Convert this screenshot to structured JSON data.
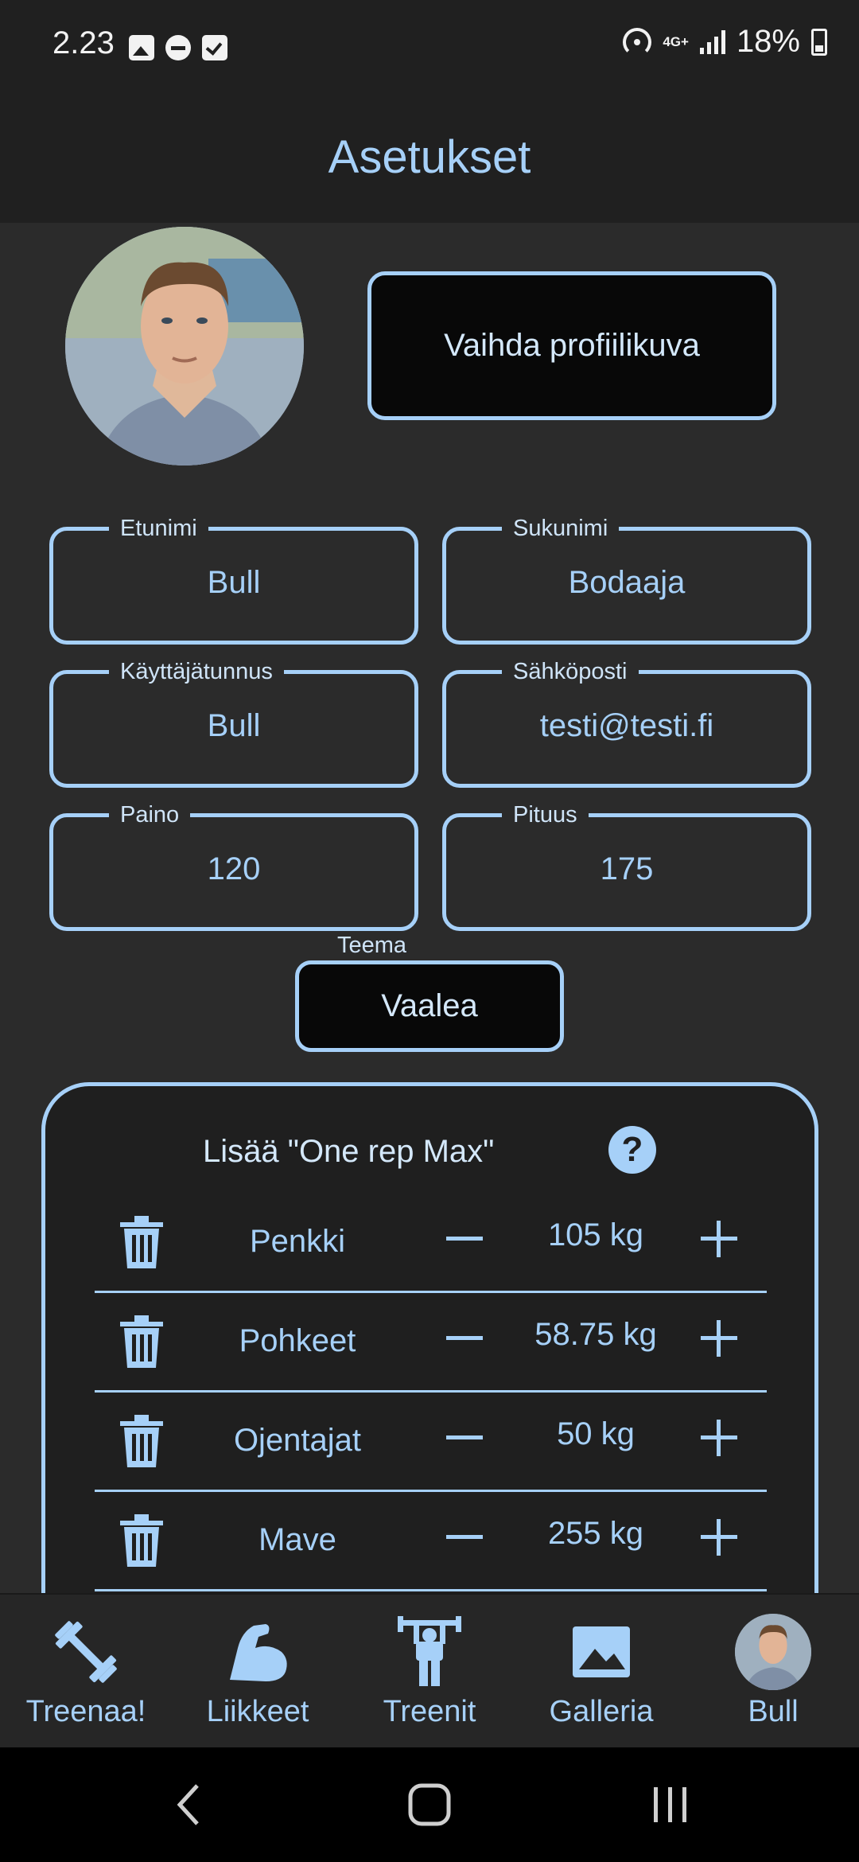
{
  "status_bar": {
    "time": "2.23",
    "network": "4G+",
    "battery": "18%"
  },
  "app_bar": {
    "title": "Asetukset"
  },
  "profile": {
    "change_photo_label": "Vaihda profiilikuva"
  },
  "fields": {
    "first_name": {
      "label": "Etunimi",
      "value": "Bull"
    },
    "last_name": {
      "label": "Sukunimi",
      "value": "Bodaaja"
    },
    "username": {
      "label": "Käyttäjätunnus",
      "value": "Bull"
    },
    "email": {
      "label": "Sähköposti",
      "value": "testi@testi.fi"
    },
    "weight": {
      "label": "Paino",
      "value": "120"
    },
    "height": {
      "label": "Pituus",
      "value": "175"
    }
  },
  "theme": {
    "label": "Teema",
    "value": "Vaalea"
  },
  "one_rep_max": {
    "title": "Lisää \"One rep Max\"",
    "rows": [
      {
        "name": "Penkki",
        "weight": "105 kg"
      },
      {
        "name": "Pohkeet",
        "weight": "58.75 kg"
      },
      {
        "name": "Ojentajat",
        "weight": "50 kg"
      },
      {
        "name": "Mave",
        "weight": "255 kg"
      }
    ]
  },
  "bottom_nav": {
    "items": [
      {
        "label": "Treenaa!",
        "icon": "dumbbell-icon"
      },
      {
        "label": "Liikkeet",
        "icon": "biceps-icon"
      },
      {
        "label": "Treenit",
        "icon": "weightlifter-icon"
      },
      {
        "label": "Galleria",
        "icon": "image-icon"
      },
      {
        "label": "Bull",
        "icon": "avatar"
      }
    ]
  },
  "colors": {
    "accent": "#a6d0f8",
    "background": "#2b2b2b",
    "bar": "#202020",
    "card": "#1f1f1f"
  }
}
